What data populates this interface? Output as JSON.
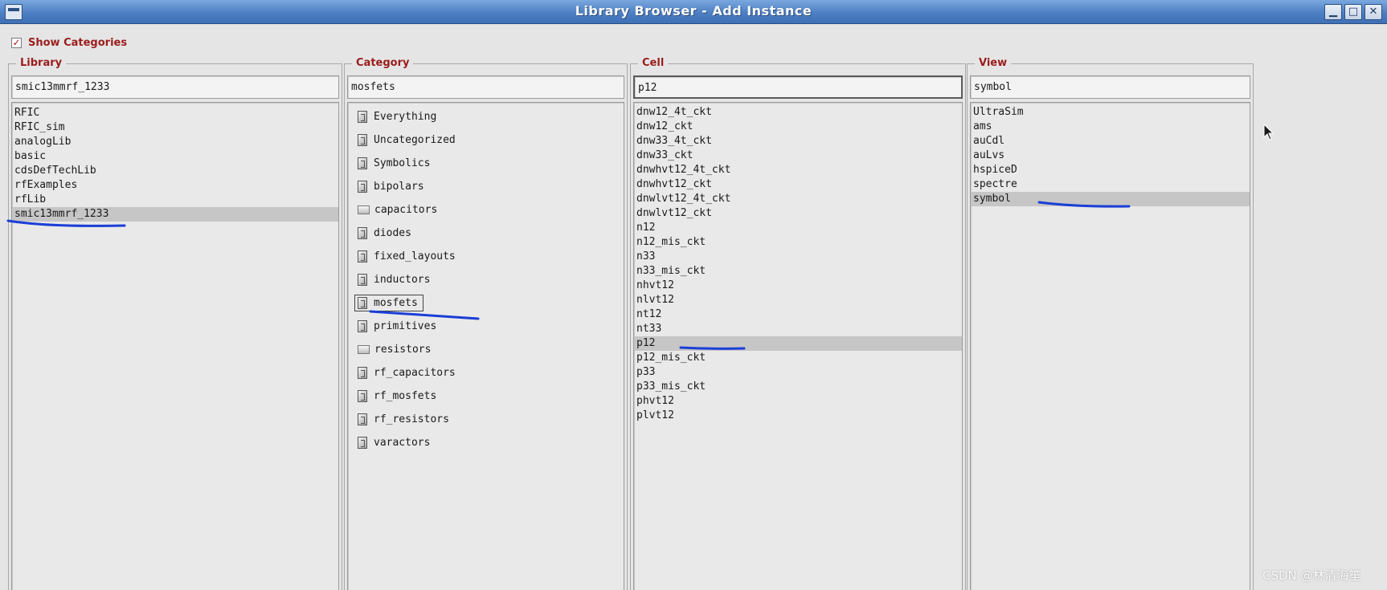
{
  "window": {
    "title": "Library Browser - Add Instance",
    "controls": {
      "minimize": "▁",
      "maximize": "□",
      "close": "✕"
    }
  },
  "show_categories": {
    "label": "Show Categories",
    "checked": true,
    "check_glyph": "✓"
  },
  "library": {
    "label": "Library",
    "value": "smic13mmrf_1233",
    "items": [
      "RFIC",
      "RFIC_sim",
      "analogLib",
      "basic",
      "cdsDefTechLib",
      "rfExamples",
      "rfLib",
      "smic13mmrf_1233"
    ],
    "selected": "smic13mmrf_1233"
  },
  "category": {
    "label": "Category",
    "value": "mosfets",
    "items": [
      {
        "label": "Everything",
        "icon": "category-doc-icon"
      },
      {
        "label": "Uncategorized",
        "icon": "category-doc-icon"
      },
      {
        "label": "Symbolics",
        "icon": "category-doc-icon"
      },
      {
        "label": "bipolars",
        "icon": "category-doc-icon"
      },
      {
        "label": "capacitors",
        "icon": "folder-icon"
      },
      {
        "label": "diodes",
        "icon": "category-doc-icon"
      },
      {
        "label": "fixed_layouts",
        "icon": "category-doc-icon"
      },
      {
        "label": "inductors",
        "icon": "category-doc-icon"
      },
      {
        "label": "mosfets",
        "icon": "category-doc-icon"
      },
      {
        "label": "primitives",
        "icon": "category-doc-icon"
      },
      {
        "label": "resistors",
        "icon": "folder-icon"
      },
      {
        "label": "rf_capacitors",
        "icon": "category-doc-icon"
      },
      {
        "label": "rf_mosfets",
        "icon": "category-doc-icon"
      },
      {
        "label": "rf_resistors",
        "icon": "category-doc-icon"
      },
      {
        "label": "varactors",
        "icon": "category-doc-icon"
      }
    ],
    "selected": "mosfets"
  },
  "cell": {
    "label": "Cell",
    "value": "p12",
    "items": [
      "dnw12_4t_ckt",
      "dnw12_ckt",
      "dnw33_4t_ckt",
      "dnw33_ckt",
      "dnwhvt12_4t_ckt",
      "dnwhvt12_ckt",
      "dnwlvt12_4t_ckt",
      "dnwlvt12_ckt",
      "n12",
      "n12_mis_ckt",
      "n33",
      "n33_mis_ckt",
      "nhvt12",
      "nlvt12",
      "nt12",
      "nt33",
      "p12",
      "p12_mis_ckt",
      "p33",
      "p33_mis_ckt",
      "phvt12",
      "plvt12"
    ],
    "selected": "p12"
  },
  "view": {
    "label": "View",
    "value": "symbol",
    "items": [
      "UltraSim",
      "ams",
      "auCdl",
      "auLvs",
      "hspiceD",
      "spectre",
      "symbol"
    ],
    "selected": "symbol"
  },
  "watermark": "CSDN @林清海笙",
  "colors": {
    "label_red": "#9b1c1c",
    "title_blue": "#4d7fc4",
    "annotation_blue": "#1a3fd6",
    "selection_gray": "#c6c6c6"
  }
}
